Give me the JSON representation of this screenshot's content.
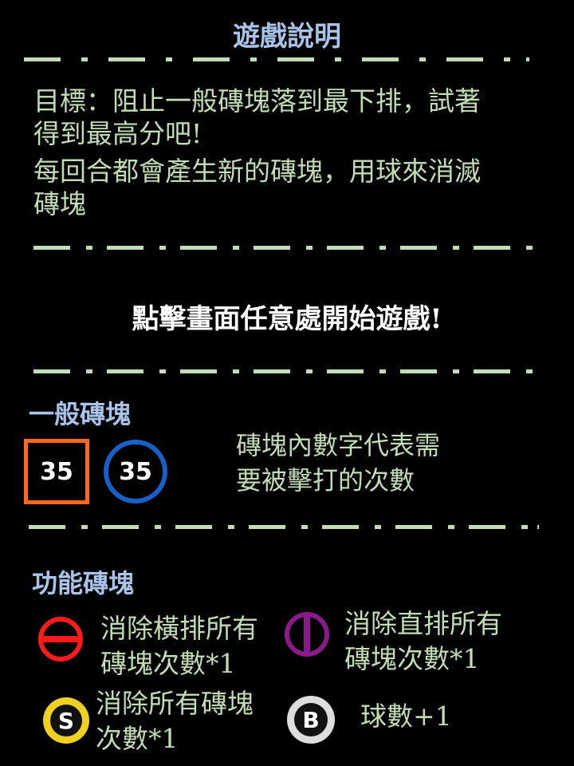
{
  "title": "遊戲說明",
  "goal": {
    "line1": "目標：阻止一般磚塊落到最下排，試著",
    "line2": "得到最高分吧!",
    "line3": "每回合都會產生新的磚塊，用球來消滅",
    "line4": "磚塊"
  },
  "start_prompt": "點擊畫面任意處開始遊戲!",
  "normal": {
    "heading": "一般磚塊",
    "square_value": "35",
    "circle_value": "35",
    "desc_line1": "磚塊內數字代表需",
    "desc_line2": "要被擊打的次數"
  },
  "functional": {
    "heading": "功能磚塊",
    "items": [
      {
        "icon": "horizontal-clear-icon",
        "line1": "消除橫排所有",
        "line2": "磚塊次數*1",
        "color": "#ff1a1a"
      },
      {
        "icon": "vertical-clear-icon",
        "line1": "消除直排所有",
        "line2": "磚塊次數*1",
        "color": "#8a1a8a"
      },
      {
        "icon": "all-clear-icon",
        "line1": "消除所有磚塊",
        "line2": "次數*1",
        "color": "#f0d020",
        "glyph": "S"
      },
      {
        "icon": "ball-plus-icon",
        "line1": "球數+1",
        "color": "#dddddd",
        "glyph": "B"
      }
    ]
  },
  "colors": {
    "heading": "#a9c4e8",
    "body_text": "#c2dcb4",
    "divider": "#c2dcb4",
    "square_border": "#ff6a1a",
    "circle_border": "#1860c8"
  }
}
